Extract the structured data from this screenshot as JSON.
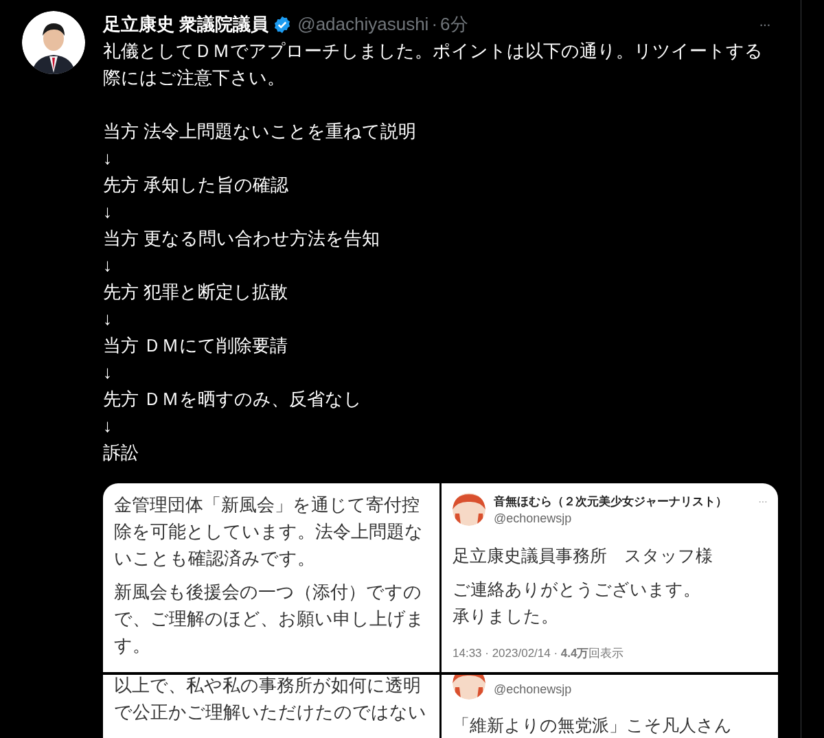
{
  "tweet": {
    "author": {
      "name": "足立康史 衆議院議員",
      "verified": true,
      "handle": "@adachiyasushi",
      "separator": "·",
      "time": "6分",
      "more": "···"
    },
    "intro": "礼儀としてＤＭでアプローチしました。ポイントは以下の通り。リツイートする際にはご注意下さい。",
    "steps": [
      "当方 法令上問題ないことを重ねて説明",
      "↓",
      "先方 承知した旨の確認",
      "↓",
      "当方 更なる問い合わせ方法を告知",
      "↓",
      "先方 犯罪と断定し拡散",
      "↓",
      "当方 ＤＭにて削除要請",
      "↓",
      "先方 ＤＭを晒すのみ、反省なし",
      "↓",
      "訴訟"
    ],
    "media": [
      {
        "kind": "note",
        "paragraphs": [
          "金管理団体「新風会」を通じて寄付控除を可能としています。法令上問題ないことも確認済みです。",
          "新風会も後援会の一つ（添付）ですので、ご理解のほど、お願い申し上げます。"
        ]
      },
      {
        "kind": "tweet",
        "author": "音無ほむら（２次元美少女ジャーナリスト）",
        "handle": "@echonewsjp",
        "more": "···",
        "paragraphs": [
          [
            "足立康史議員事務所　スタッフ様"
          ],
          [
            "ご連絡ありがとうございます。",
            "承りました。"
          ]
        ],
        "meta": "14:33 · 2023/02/14 · **4.4万**回表示"
      },
      {
        "kind": "note",
        "paragraphs": [
          "以上で、私や私の事務所が如何に透明で公正かご理解いただけたのではない"
        ]
      },
      {
        "kind": "tweet",
        "handle": "@echonewsjp",
        "paragraphs": [
          [
            "「維新よりの無党派」こそ凡人さん"
          ]
        ]
      }
    ]
  }
}
